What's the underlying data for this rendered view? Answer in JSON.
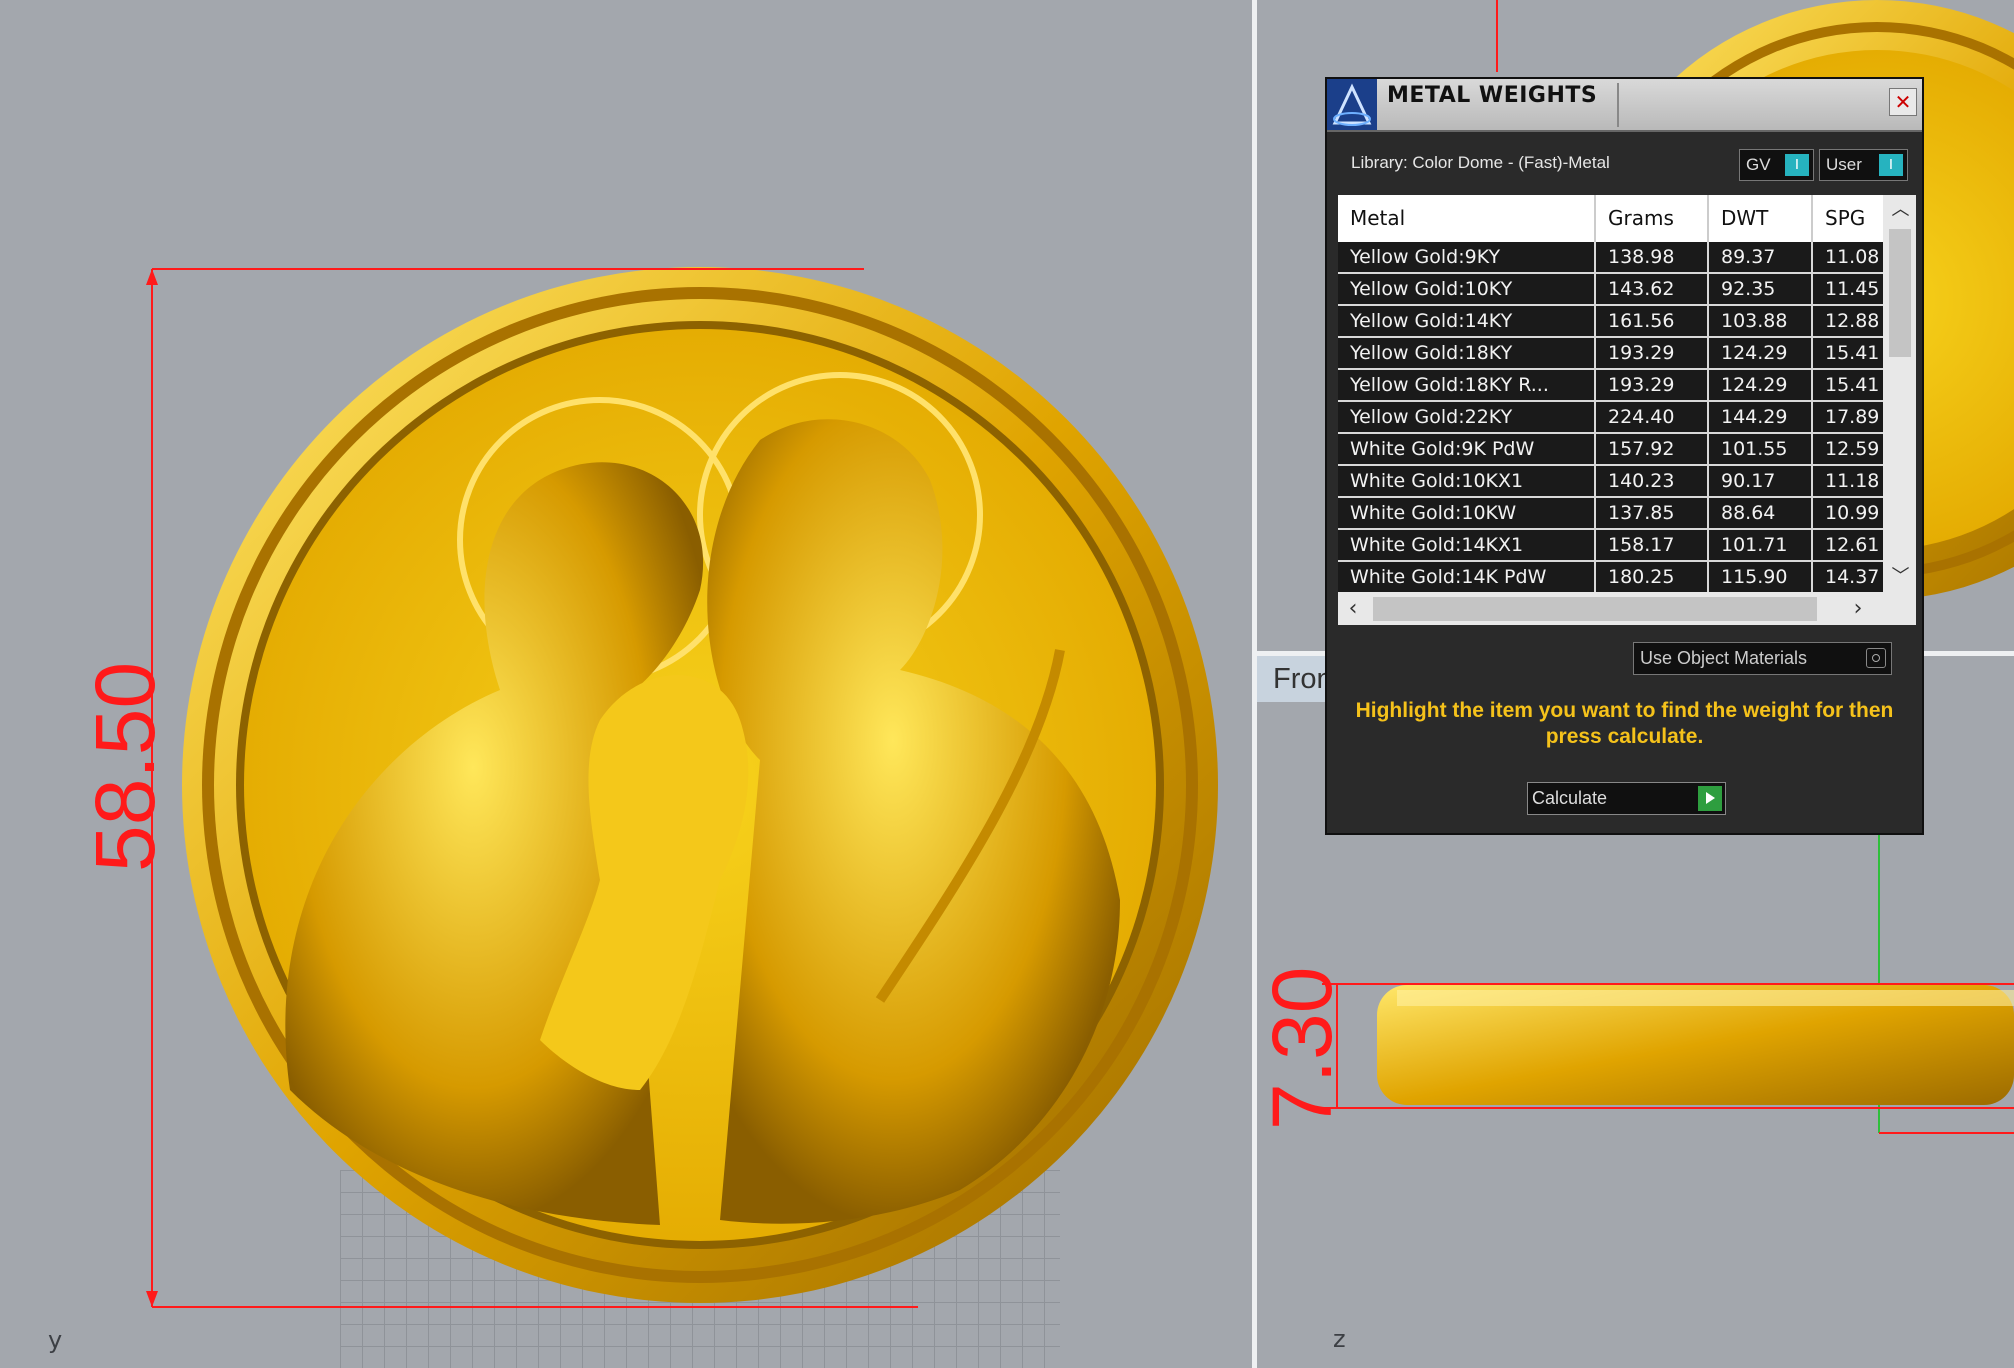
{
  "left_view": {
    "dimension": "58.50",
    "axis_label": "y"
  },
  "right_view": {
    "dimension": "7.30",
    "axis_label": "z",
    "viewport_label": "Fron"
  },
  "colors": {
    "gold": "#f2c300",
    "dimension_red": "#ff1a1a",
    "instruction_yellow": "#f5c21b",
    "toggle_accent": "#26b3bf"
  },
  "dialog": {
    "title": "METAL WEIGHTS",
    "close_icon": "close-icon",
    "library": "Library: Color Dome - (Fast)-Metal",
    "toggle_gv": "GV",
    "toggle_user": "User",
    "toggle_knob": "I",
    "columns": [
      "Metal",
      "Grams",
      "DWT",
      "SPG"
    ],
    "rows": [
      [
        "Yellow Gold:9KY",
        "138.98",
        "89.37",
        "11.08"
      ],
      [
        "Yellow Gold:10KY",
        "143.62",
        "92.35",
        "11.45"
      ],
      [
        "Yellow Gold:14KY",
        "161.56",
        "103.88",
        "12.88"
      ],
      [
        "Yellow Gold:18KY",
        "193.29",
        "124.29",
        "15.41"
      ],
      [
        "Yellow Gold:18KY R...",
        "193.29",
        "124.29",
        "15.41"
      ],
      [
        "Yellow Gold:22KY",
        "224.40",
        "144.29",
        "17.89"
      ],
      [
        "White Gold:9K PdW",
        "157.92",
        "101.55",
        "12.59"
      ],
      [
        "White Gold:10KX1",
        "140.23",
        "90.17",
        "11.18"
      ],
      [
        "White Gold:10KW",
        "137.85",
        "88.64",
        "10.99"
      ],
      [
        "White Gold:14KX1",
        "158.17",
        "101.71",
        "12.61"
      ],
      [
        "White Gold:14K PdW",
        "180.25",
        "115.90",
        "14.37"
      ]
    ],
    "use_object_materials": "Use Object Materials",
    "instruction": "Highlight the item you want to find the weight for then press calculate.",
    "calculate": "Calculate"
  }
}
